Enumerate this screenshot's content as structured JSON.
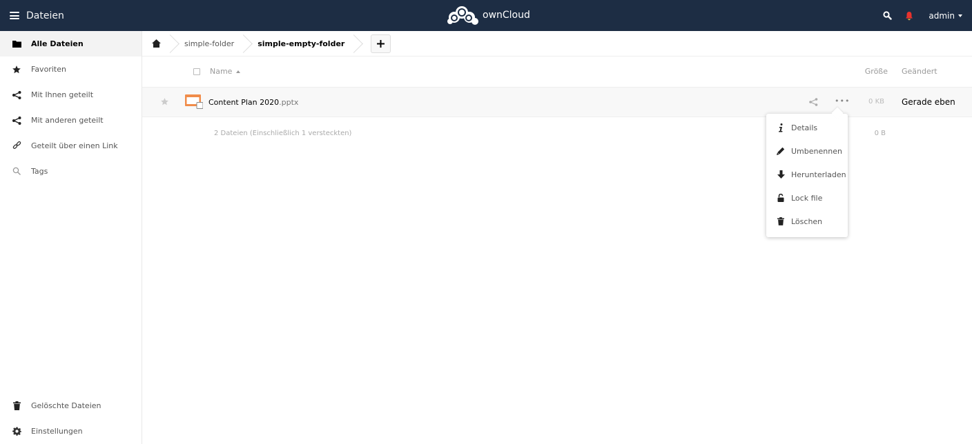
{
  "header": {
    "app_name": "Dateien",
    "brand": "ownCloud",
    "user": "admin"
  },
  "sidebar": {
    "items": [
      {
        "label": "Alle Dateien",
        "icon": "folder-icon",
        "active": true
      },
      {
        "label": "Favoriten",
        "icon": "star-icon"
      },
      {
        "label": "Mit Ihnen geteilt",
        "icon": "share-icon"
      },
      {
        "label": "Mit anderen geteilt",
        "icon": "share-icon"
      },
      {
        "label": "Geteilt über einen Link",
        "icon": "link-icon"
      },
      {
        "label": "Tags",
        "icon": "tag-search-icon"
      }
    ],
    "bottom": [
      {
        "label": "Gelöschte Dateien",
        "icon": "trash-icon"
      },
      {
        "label": "Einstellungen",
        "icon": "gear-icon"
      }
    ]
  },
  "breadcrumb": [
    "simple-folder",
    "simple-empty-folder"
  ],
  "table": {
    "headers": {
      "name": "Name",
      "size": "Größe",
      "modified": "Geändert"
    },
    "files": [
      {
        "basename": "Content Plan 2020",
        "extension": ".pptx",
        "size": "0 KB",
        "modified": "Gerade eben"
      }
    ],
    "summary": {
      "info": "2 Dateien (Einschließlich 1 versteckten)",
      "total": "0 B"
    }
  },
  "file_menu": {
    "items": [
      {
        "label": "Details",
        "icon": "info-icon"
      },
      {
        "label": "Umbenennen",
        "icon": "pencil-icon"
      },
      {
        "label": "Herunterladen",
        "icon": "download-icon"
      },
      {
        "label": "Lock file",
        "icon": "lock-icon"
      },
      {
        "label": "Löschen",
        "icon": "trash-icon"
      }
    ]
  },
  "colors": {
    "header_bg": "#1d2d44",
    "accent_orange": "#f08c4a",
    "notification": "#e9322d"
  }
}
